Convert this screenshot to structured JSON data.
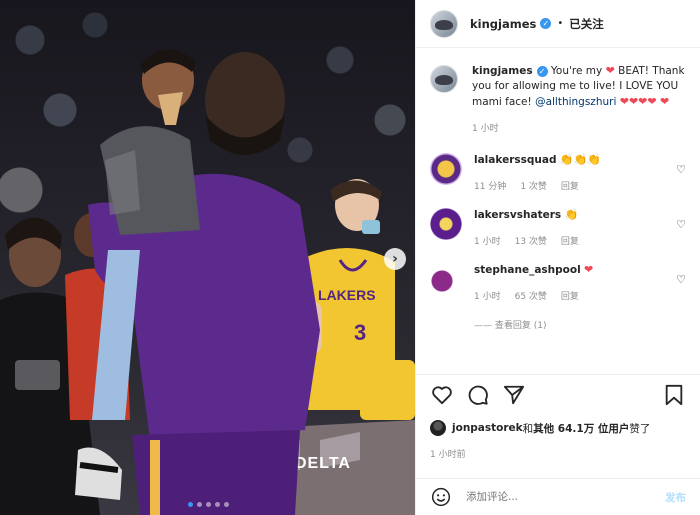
{
  "post": {
    "author": "kingjames",
    "follow_state": "已关注",
    "separator": "•"
  },
  "caption": {
    "author": "kingjames",
    "text_1": " You're my ",
    "text_2": " BEAT! Thank you for allowing me to live! I LOVE YOU mami face! ",
    "mention": "@allthingszhuri",
    "heart": "❤",
    "time": "1 小时"
  },
  "comments": [
    {
      "user": "lalakerssquad",
      "emoji": "👏👏👏",
      "time": "11 分钟",
      "likes": "1 次赞",
      "reply": "回复"
    },
    {
      "user": "lakersvshaters",
      "emoji": "👏",
      "time": "1 小时",
      "likes": "13 次赞",
      "reply": "回复"
    },
    {
      "user": "stephane_ashpool",
      "emoji": "❤",
      "time": "1 小时",
      "likes": "65 次赞",
      "reply": "回复"
    }
  ],
  "more_replies": "—— 查看回复 (1)",
  "likes": {
    "user": "jonpastorek",
    "joiner": " 和 ",
    "others": "其他 64.1万 位用户",
    "suffix": " 赞了"
  },
  "post_time": "1 小时前",
  "add_comment": {
    "placeholder": "添加评论...",
    "post_label": "发布"
  },
  "jersey_number": "3",
  "jersey_text": "LAKERS",
  "court_text": "DELTA",
  "colors": {
    "purple": "#552583",
    "gold": "#fdb927",
    "blue": "#3897f0",
    "red": "#ed4956"
  }
}
